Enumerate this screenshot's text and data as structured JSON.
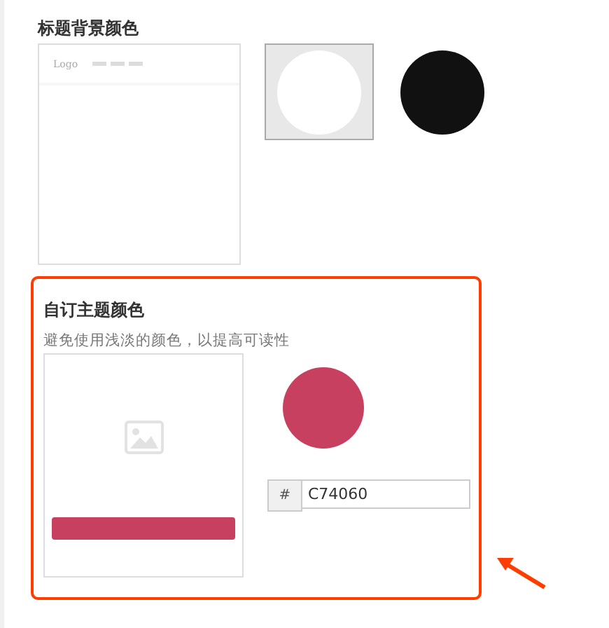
{
  "title_background": {
    "title": "标题背景颜色",
    "preview": {
      "logo": "Logo"
    },
    "swatches": [
      {
        "color": "#ffffff",
        "selected": true
      },
      {
        "color": "#111111",
        "selected": false
      }
    ]
  },
  "custom_theme": {
    "highlighted": true,
    "title": "自订主题颜色",
    "hint": "避免使用浅淡的颜色，以提高可读性",
    "hash": "#",
    "value": "C74060"
  }
}
